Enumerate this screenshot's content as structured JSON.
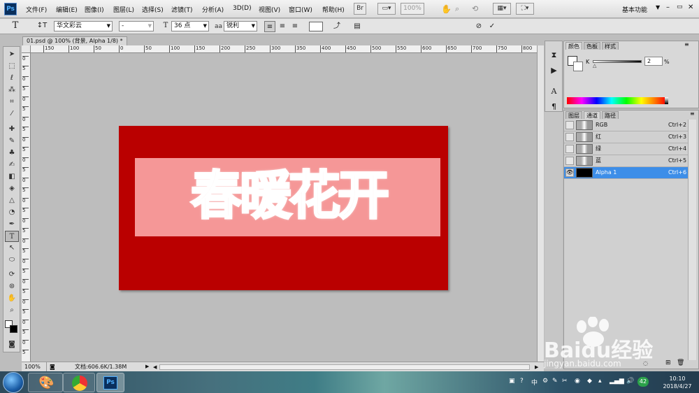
{
  "app": {
    "logo": "Ps"
  },
  "menu": [
    "文件(F)",
    "编辑(E)",
    "图像(I)",
    "图层(L)",
    "选择(S)",
    "滤镜(T)",
    "分析(A)",
    "3D(D)",
    "视图(V)",
    "窗口(W)",
    "帮助(H)"
  ],
  "menu_right": {
    "zoom": "100%",
    "workspace": "基本功能"
  },
  "options": {
    "font_family": "华文彩云",
    "font_style": "-",
    "font_size": "36 点",
    "aa_label": "aa",
    "antialias": "锐利"
  },
  "document": {
    "tab_title": "01.psd @ 100% (背景, Alpha 1/8) *",
    "text": "春暖花开",
    "status_zoom": "100%",
    "status_info": "文档:606.6K/1.38M"
  },
  "rulers": {
    "top": [
      "150",
      "100",
      "50",
      "0",
      "50",
      "100",
      "150",
      "200",
      "250",
      "300",
      "350",
      "400",
      "450",
      "500",
      "550",
      "600",
      "650",
      "700",
      "750",
      "800"
    ],
    "left": [
      "0",
      "5",
      "0",
      "5",
      "0",
      "5",
      "0",
      "5",
      "0",
      "5",
      "0",
      "5",
      "0",
      "5",
      "0",
      "5",
      "0",
      "5",
      "0",
      "5",
      "0",
      "5",
      "0",
      "5",
      "0",
      "5",
      "0",
      "5",
      "0",
      "5"
    ]
  },
  "color_panel": {
    "tabs": [
      "颜色",
      "色板",
      "样式"
    ],
    "k_label": "K",
    "k_value": "2",
    "k_unit": "%"
  },
  "channels_panel": {
    "tabs": [
      "图层",
      "通道",
      "路径"
    ],
    "rows": [
      {
        "name": "RGB",
        "shortcut": "Ctrl+2"
      },
      {
        "name": "红",
        "shortcut": "Ctrl+3"
      },
      {
        "name": "绿",
        "shortcut": "Ctrl+4"
      },
      {
        "name": "蓝",
        "shortcut": "Ctrl+5"
      },
      {
        "name": "Alpha 1",
        "shortcut": "Ctrl+6"
      }
    ],
    "active_color": "#3d8ee8"
  },
  "taskbar": {
    "time": "10:10",
    "date": "2018/4/27",
    "ime": "中",
    "badge": "42"
  },
  "watermark": {
    "brand": "Baidu经验",
    "url": "jingyan.baidu.com"
  },
  "colors": {
    "canvas": "#ba0000",
    "selection": "#f59797"
  }
}
